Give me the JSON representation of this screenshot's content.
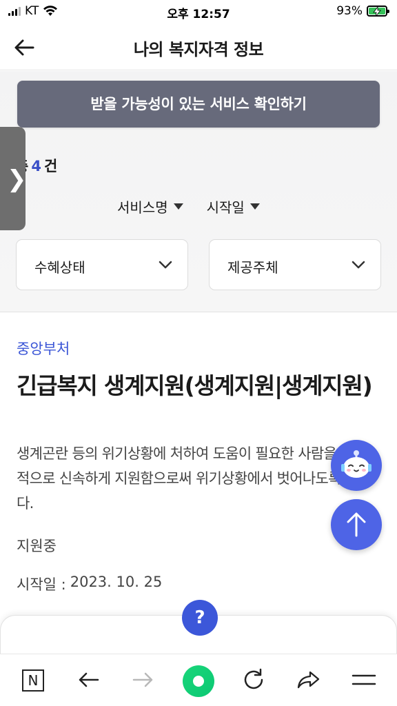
{
  "status_bar": {
    "carrier": "KT",
    "time": "오후 12:57",
    "battery": "93%"
  },
  "header": {
    "title": "나의 복지자격 정보",
    "back_icon": "arrow-left-icon"
  },
  "filters": {
    "check_button": "받을 가능성이 있는 서비스 확인하기",
    "total_prefix": "총",
    "total_count": "4",
    "total_suffix": "건",
    "sort_options": [
      "서비스명",
      "시작일"
    ],
    "selects": {
      "status": "수혜상태",
      "provider": "제공주체"
    }
  },
  "side_tab": {
    "glyph": "❯"
  },
  "service": {
    "category": "중앙부처",
    "title": "긴급복지 생계지원(생계지원|생계지원)",
    "description": "생계곤란 등의 위기상황에 처하여 도움이 필요한 사람을 일시적으로 신속하게 지원함으로써 위기상황에서 벗어나도록 합니다.",
    "status": "지원중",
    "start_label": "시작일 :",
    "start_date": "2023. 10. 25"
  },
  "help": {
    "label": "?"
  },
  "toolbar": {
    "home_label": "N"
  },
  "colors": {
    "accent": "#4e64e6",
    "button_gray": "#676a7b",
    "category_blue": "#3a55d6",
    "naver_green": "#0bc873"
  }
}
